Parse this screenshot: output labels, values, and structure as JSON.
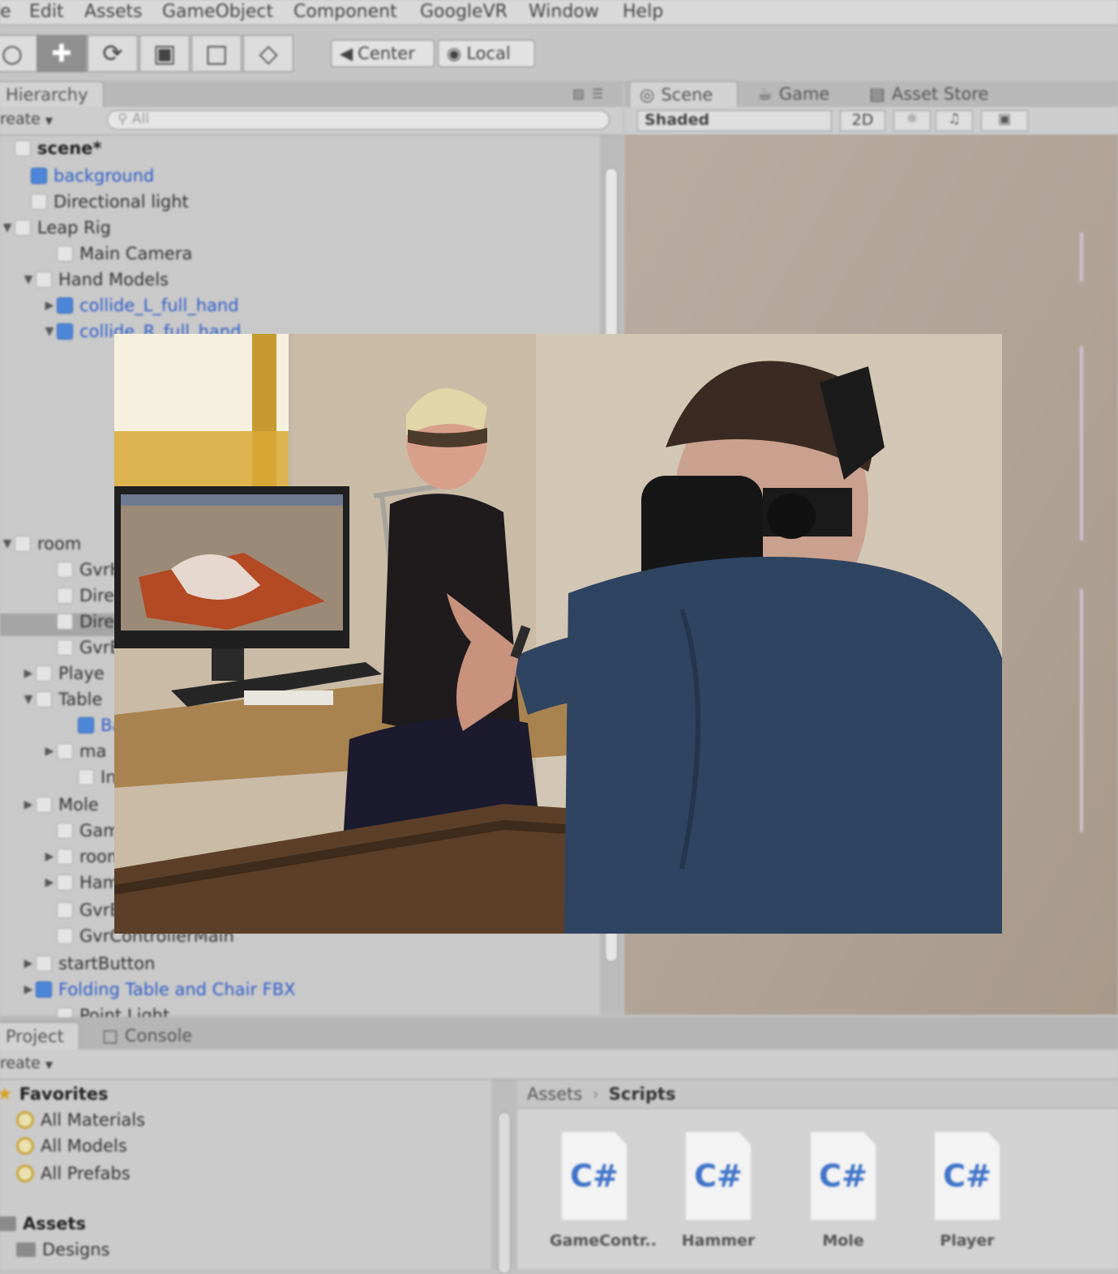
{
  "menu": [
    "e",
    "Edit",
    "Assets",
    "GameObject",
    "Component",
    "GoogleVR",
    "Window",
    "Help"
  ],
  "toolbar": {
    "tools": [
      "hand-icon",
      "move-icon",
      "rotate-icon",
      "scale-icon",
      "rect-icon",
      "transform-icon"
    ],
    "center_label": "Center",
    "local_label": "Local"
  },
  "hierarchy": {
    "tab_label": "Hierarchy",
    "create_label": "reate",
    "search_placeholder": "All",
    "rows": [
      {
        "label": "scene*",
        "kind": "scene"
      },
      {
        "label": "background",
        "kind": "prefab"
      },
      {
        "label": "Directional light",
        "kind": "object"
      },
      {
        "label": "Leap Rig",
        "kind": "object"
      },
      {
        "label": "Main Camera",
        "kind": "object"
      },
      {
        "label": "Hand Models",
        "kind": "object"
      },
      {
        "label": "collide_L_full_hand",
        "kind": "prefab"
      },
      {
        "label": "collide_R_full_hand",
        "kind": "prefab"
      },
      {
        "label": "room",
        "kind": "object"
      },
      {
        "label": "GvrH",
        "kind": "object"
      },
      {
        "label": "Direc",
        "kind": "object"
      },
      {
        "label": "Direc",
        "kind": "object"
      },
      {
        "label": "GvrE",
        "kind": "object"
      },
      {
        "label": "Playe",
        "kind": "object"
      },
      {
        "label": "Table",
        "kind": "object"
      },
      {
        "label": "Ba",
        "kind": "prefab"
      },
      {
        "label": "ma",
        "kind": "object"
      },
      {
        "label": "Inf",
        "kind": "object"
      },
      {
        "label": "Mole",
        "kind": "object"
      },
      {
        "label": "Gam",
        "kind": "object"
      },
      {
        "label": "room",
        "kind": "object"
      },
      {
        "label": "Ham",
        "kind": "object"
      },
      {
        "label": "GvrE",
        "kind": "object"
      },
      {
        "label": "GvrControllerMain",
        "kind": "object"
      },
      {
        "label": "startButton",
        "kind": "object"
      },
      {
        "label": "Folding Table and Chair FBX",
        "kind": "prefab"
      },
      {
        "label": "Point Light",
        "kind": "object"
      }
    ]
  },
  "scene_panel": {
    "tabs": [
      "Scene",
      "Game",
      "Asset Store"
    ],
    "shading_mode": "Shaded",
    "mode_2d": "2D"
  },
  "project": {
    "tabs": [
      "Project",
      "Console"
    ],
    "create_label": "reate",
    "favorites_label": "Favorites",
    "favorites": [
      "All Materials",
      "All Models",
      "All Prefabs"
    ],
    "assets_label": "Assets",
    "asset_folders": [
      "Designs"
    ],
    "breadcrumb": [
      "Assets",
      "Scripts"
    ],
    "files": [
      {
        "name": "GameContr..",
        "type": "C#"
      },
      {
        "name": "Hammer",
        "type": "C#"
      },
      {
        "name": "Mole",
        "type": "C#"
      },
      {
        "name": "Player",
        "type": "C#"
      }
    ]
  },
  "colors": {
    "prefab_blue": "#2e5cc7",
    "panel_gray": "#c9c9c9",
    "scene_beige": "#b0a396"
  }
}
